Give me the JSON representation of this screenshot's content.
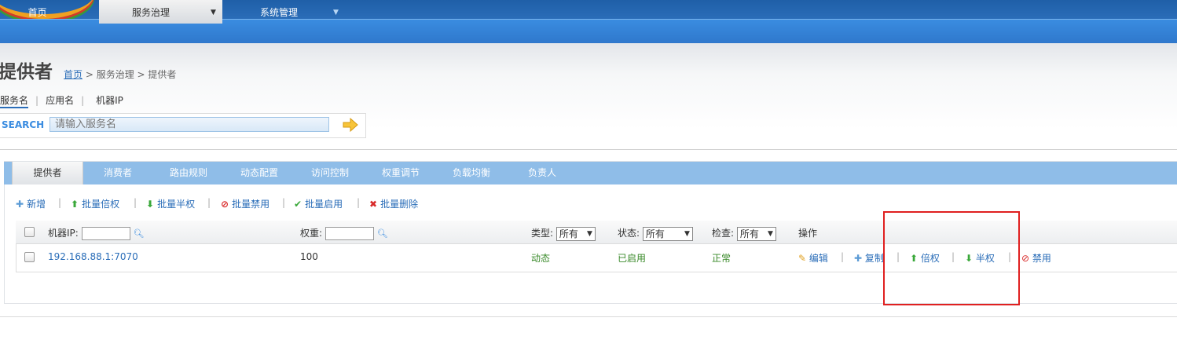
{
  "nav": {
    "items": [
      {
        "label": "首页"
      },
      {
        "label": "服务治理"
      },
      {
        "label": "系统管理"
      }
    ]
  },
  "page": {
    "title": "提供者",
    "breadcrumb": {
      "home": "首页",
      "rest": " > 服务治理 > 提供者"
    }
  },
  "search": {
    "tabs": [
      "服务名",
      "应用名",
      "机器IP"
    ],
    "label": "SEARCH",
    "placeholder": "请输入服务名"
  },
  "tabs": [
    "提供者",
    "消费者",
    "路由规则",
    "动态配置",
    "访问控制",
    "权重调节",
    "负载均衡",
    "负责人"
  ],
  "actions": {
    "add": {
      "icon": "✚",
      "label": "新增"
    },
    "batch_double": {
      "icon": "⬆",
      "label": "批量倍权"
    },
    "batch_half": {
      "icon": "⬇",
      "label": "批量半权"
    },
    "batch_disable": {
      "icon": "⊘",
      "label": "批量禁用"
    },
    "batch_enable": {
      "icon": "✔",
      "label": "批量启用"
    },
    "batch_delete": {
      "icon": "✖",
      "label": "批量删除"
    }
  },
  "table": {
    "headers": {
      "ip": "机器IP:",
      "weight": "权重:",
      "type": "类型:",
      "type_value": "所有",
      "status": "状态:",
      "status_value": "所有",
      "check": "检查:",
      "check_value": "所有",
      "ops": "操作"
    },
    "rows": [
      {
        "ip": "192.168.88.1:7070",
        "weight": "100",
        "type": "动态",
        "status": "已启用",
        "check": "正常",
        "ops": {
          "edit": "编辑",
          "copy": "复制",
          "double": "倍权",
          "half": "半权",
          "disable": "禁用"
        }
      }
    ]
  },
  "colors": {
    "banner": "#2a6db8",
    "nav": "#3a8ce0",
    "tab_strip": "#8fbde8",
    "link": "#2a6db8",
    "ok": "#3a8a2a",
    "highlight": "#e02020"
  }
}
